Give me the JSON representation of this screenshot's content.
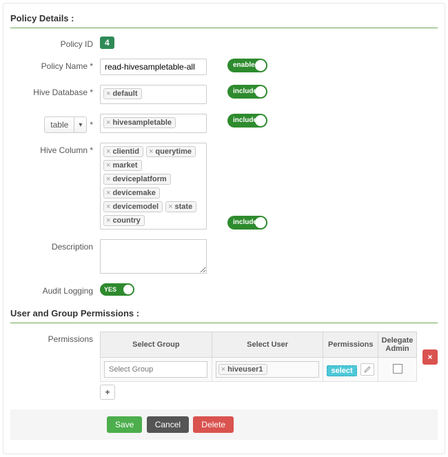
{
  "sections": {
    "policy_details_title": "Policy Details :",
    "user_group_perm_title": "User and Group Permissions :"
  },
  "labels": {
    "policy_id": "Policy ID",
    "policy_name": "Policy Name *",
    "hive_database": "Hive Database *",
    "table_select": "table",
    "table_asterisk": "*",
    "hive_column": "Hive Column *",
    "description": "Description",
    "audit_logging": "Audit Logging",
    "permissions": "Permissions"
  },
  "values": {
    "policy_id": "4",
    "policy_name": "read-hivesampletable-all",
    "description": ""
  },
  "tags": {
    "hive_database": [
      "default"
    ],
    "table": [
      "hivesampletable"
    ],
    "hive_column": [
      "clientid",
      "querytime",
      "market",
      "deviceplatform",
      "devicemake",
      "devicemodel",
      "state",
      "country"
    ]
  },
  "toggles": {
    "policy_enabled": "enabled",
    "db_include": "include",
    "table_include": "include",
    "column_include": "include",
    "audit_yes": "YES"
  },
  "perm_table": {
    "headers": {
      "select_group": "Select Group",
      "select_user": "Select User",
      "permissions": "Permissions",
      "delegate_admin": "Delegate Admin"
    },
    "row": {
      "group_placeholder": "Select Group",
      "users": [
        "hiveuser1"
      ],
      "perm_chip": "select",
      "delegate_checked": false
    }
  },
  "buttons": {
    "save": "Save",
    "cancel": "Cancel",
    "delete": "Delete",
    "add_row": "+",
    "del_row": "×"
  }
}
